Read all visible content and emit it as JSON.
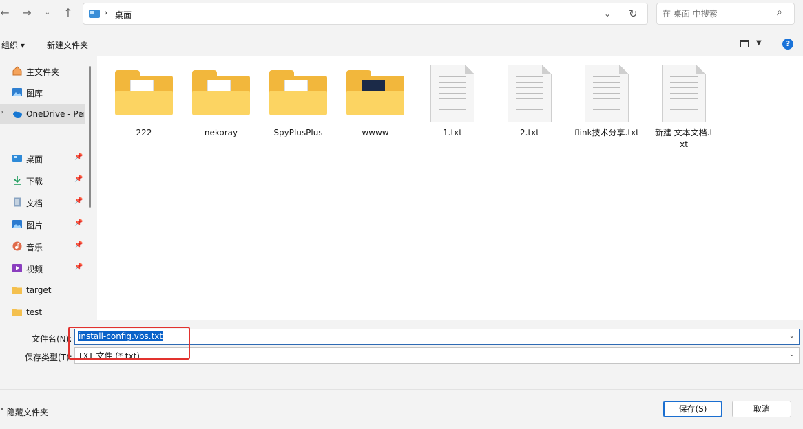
{
  "address": {
    "location": "桌面"
  },
  "search": {
    "placeholder": "在 桌面 中搜索"
  },
  "toolbar": {
    "organize": "组织 ▾",
    "new_folder": "新建文件夹"
  },
  "nav": {
    "items": [
      {
        "label": "主文件夹",
        "icon": "home-icon"
      },
      {
        "label": "图库",
        "icon": "gallery-icon"
      },
      {
        "label": "OneDrive - Personal",
        "icon": "onedrive-icon"
      },
      {
        "label": "桌面",
        "icon": "desktop-icon"
      },
      {
        "label": "下载",
        "icon": "download-icon"
      },
      {
        "label": "文档",
        "icon": "documents-icon"
      },
      {
        "label": "图片",
        "icon": "pictures-icon"
      },
      {
        "label": "音乐",
        "icon": "music-icon"
      },
      {
        "label": "视频",
        "icon": "videos-icon"
      },
      {
        "label": "target",
        "icon": "folder-icon"
      },
      {
        "label": "test",
        "icon": "folder-icon"
      }
    ]
  },
  "files": [
    {
      "name": "222",
      "type": "folder"
    },
    {
      "name": "nekoray",
      "type": "folder"
    },
    {
      "name": "SpyPlusPlus",
      "type": "folder"
    },
    {
      "name": "wwww",
      "type": "folder"
    },
    {
      "name": "1.txt",
      "type": "txt"
    },
    {
      "name": "2.txt",
      "type": "txt"
    },
    {
      "name": "flink技术分享.txt",
      "type": "txt"
    },
    {
      "name": "新建 文本文档.txt",
      "type": "txt"
    }
  ],
  "form": {
    "filename_label": "文件名(N):",
    "filename_value": "install-config.vbs.txt",
    "filetype_label": "保存类型(T):",
    "filetype_value": "TXT 文件 (*.txt)"
  },
  "footer": {
    "hide_folders": "隐藏文件夹",
    "save": "保存(S)",
    "cancel": "取消"
  },
  "colors": {
    "accent": "#0a62c9",
    "highlight_box": "#e2322e",
    "folder": "#fcd462"
  }
}
